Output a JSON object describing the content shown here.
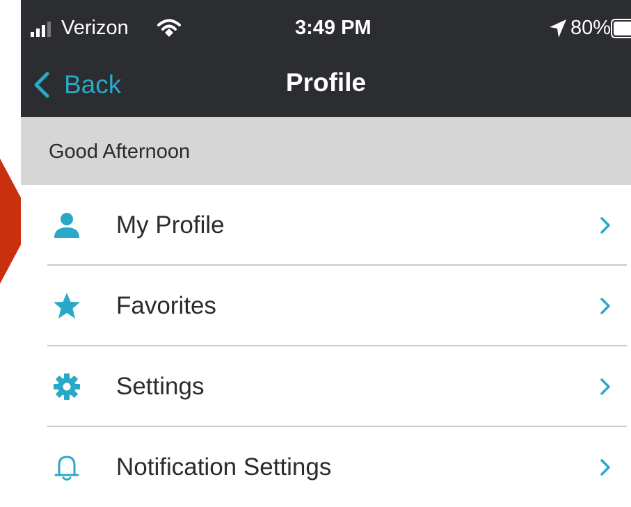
{
  "status_bar": {
    "carrier": "Verizon",
    "time": "3:49 PM",
    "battery": "80%"
  },
  "nav": {
    "back_label": "Back",
    "title": "Profile"
  },
  "greeting": "Good Afternoon",
  "menu": [
    {
      "label": "My Profile",
      "icon": "person-icon"
    },
    {
      "label": "Favorites",
      "icon": "star-icon"
    },
    {
      "label": "Settings",
      "icon": "gear-icon"
    },
    {
      "label": "Notification Settings",
      "icon": "bell-icon"
    }
  ],
  "colors": {
    "accent": "#29a9c7",
    "bar_background": "#2b2d30",
    "greeting_background": "#d6d6d6",
    "annotation": "#c8300e"
  }
}
